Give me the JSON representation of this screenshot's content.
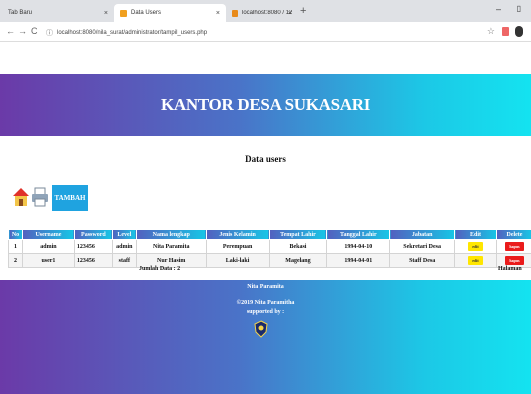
{
  "browser": {
    "tabs": [
      {
        "label": "Tab Baru",
        "active": false
      },
      {
        "label": "Data Users",
        "active": true
      },
      {
        "label": "localhost:8080 / 127.0.0.1 / nila_",
        "active": false
      }
    ],
    "url": "localhost:8080/nila_surat/administrator/tampil_users.php"
  },
  "header": {
    "title": "KANTOR DESA SUKASARI"
  },
  "section_title": "Data users",
  "toolbar": {
    "tambah_label": "TAMBAH"
  },
  "table": {
    "columns": [
      "No",
      "Username",
      "Password",
      "Level",
      "Nama lengkap",
      "Jenis Kelamin",
      "Tempat Lahir",
      "Tanggal Lahir",
      "Jabatan",
      "Edit",
      "Delete"
    ],
    "rows": [
      {
        "no": "1",
        "username": "admin",
        "password": "123456",
        "level": "admin",
        "nama": "Nita Paramita",
        "jk": "Perempuan",
        "tempat": "Bekasi",
        "tanggal": "1994-04-10",
        "jabatan": "Sekretari Desa",
        "edit": "edit",
        "delete": "hapus"
      },
      {
        "no": "2",
        "username": "user1",
        "password": "123456",
        "level": "staff",
        "nama": "Nur Hasim",
        "jk": "Laki-laki",
        "tempat": "Magelang",
        "tanggal": "1994-04-01",
        "jabatan": "Staff Desa",
        "edit": "edit",
        "delete": "hapus"
      }
    ]
  },
  "summary": {
    "jumlah": "Jumlah Data : 2",
    "halaman": "Halaman"
  },
  "footer": {
    "name": "Nita Paramita",
    "copyright": "©2019 Nita Paramitha",
    "supported": "supported by :"
  },
  "colors": {
    "header_gradient": [
      "#6b3aa8",
      "#14e3f0"
    ],
    "tambah": "#1fa3e0",
    "edit": "#ffe600",
    "hapus": "#ea1b1b"
  }
}
